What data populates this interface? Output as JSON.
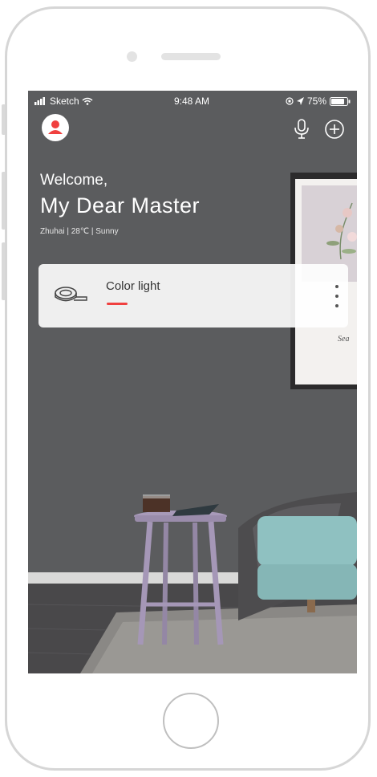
{
  "status_bar": {
    "carrier": "Sketch",
    "time": "9:48 AM",
    "battery": "75%"
  },
  "header": {
    "avatar_icon": "user-avatar-icon",
    "mic_icon": "microphone-icon",
    "add_icon": "plus-circle-icon"
  },
  "greeting": {
    "line1": "Welcome,",
    "line2": "My Dear Master",
    "weather": "Zhuhai | 28℃ | Sunny"
  },
  "devices": [
    {
      "label": "Color light",
      "icon": "light-strip-icon",
      "indicator_color": "#f0403f"
    }
  ],
  "colors": {
    "accent": "#f0403f",
    "avatar": "#f0403f",
    "wall": "#5b5c5e"
  }
}
